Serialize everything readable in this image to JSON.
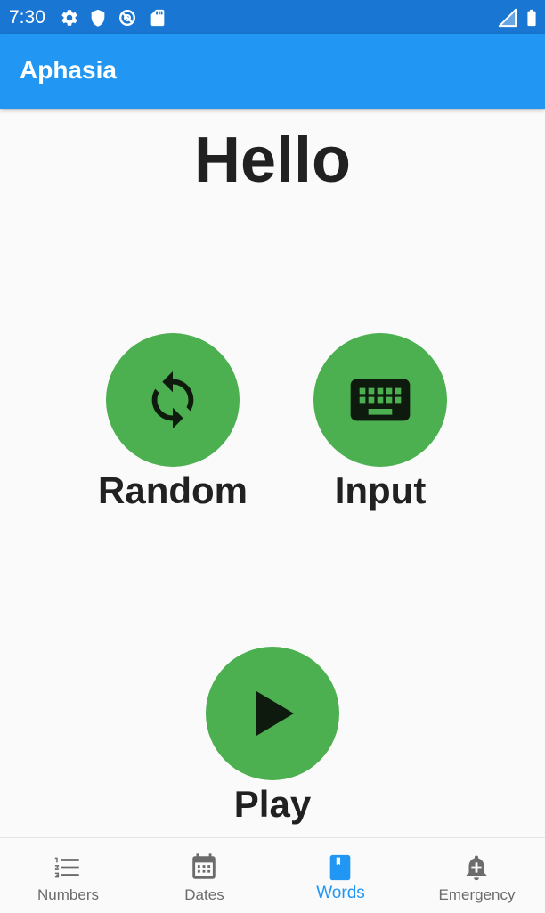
{
  "status_bar": {
    "time": "7:30",
    "left_icons": [
      "gear-icon",
      "shield-icon",
      "no-sync-icon",
      "sd-card-icon"
    ],
    "right_icons": [
      "signal-icon",
      "battery-icon"
    ]
  },
  "app_bar": {
    "title": "Aphasia"
  },
  "main": {
    "word": "Hello",
    "random_label": "Random",
    "input_label": "Input",
    "play_label": "Play"
  },
  "bottom_nav": {
    "items": [
      {
        "label": "Numbers",
        "icon": "numbered-list-icon",
        "active": false
      },
      {
        "label": "Dates",
        "icon": "calendar-icon",
        "active": false
      },
      {
        "label": "Words",
        "icon": "book-icon",
        "active": true
      },
      {
        "label": "Emergency",
        "icon": "alarm-bell-icon",
        "active": false
      }
    ]
  },
  "colors": {
    "status_bar": "#1976d2",
    "app_bar": "#2196f3",
    "action_button": "#4caf50",
    "background": "#fafafa",
    "active_nav": "#2196f3",
    "inactive_nav": "#6b6b6b"
  }
}
